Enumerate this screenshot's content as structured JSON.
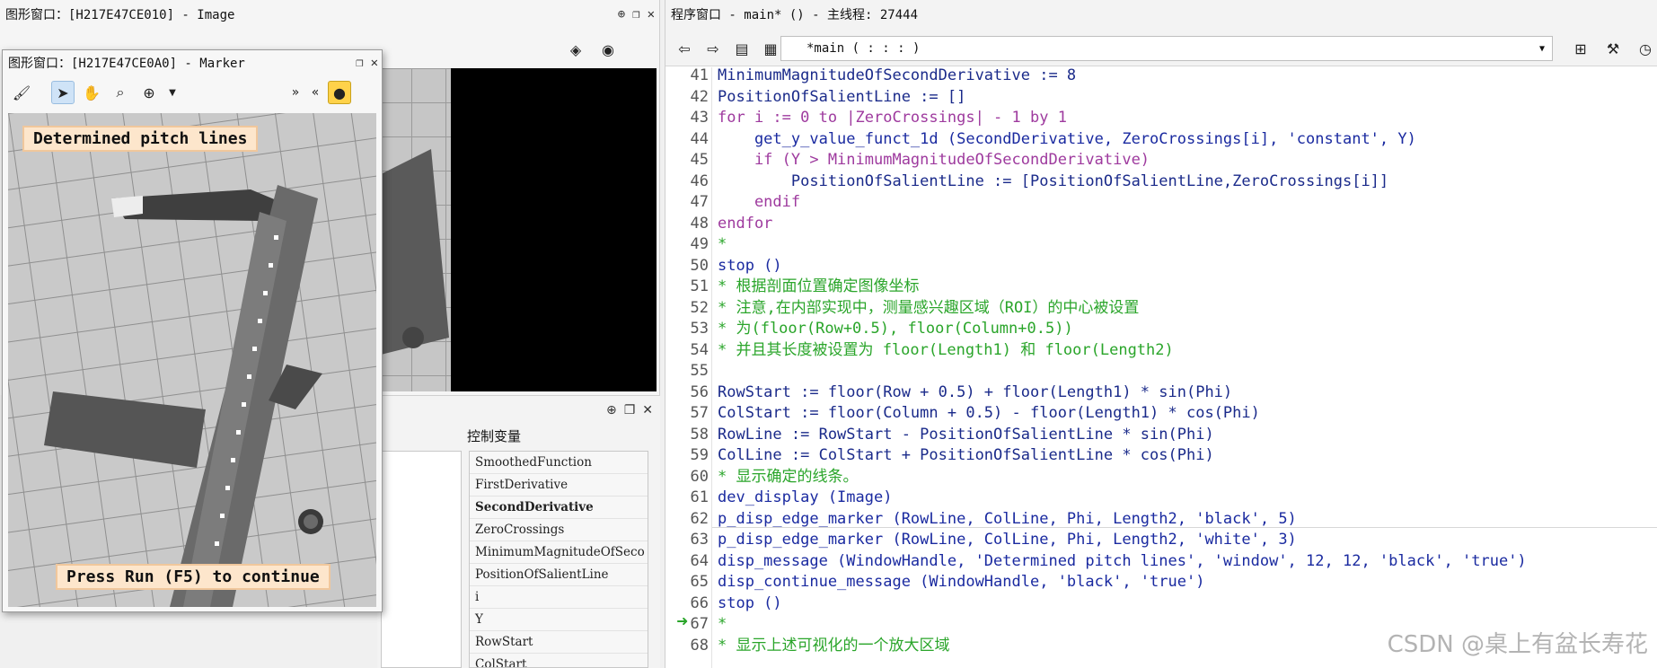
{
  "image_window": {
    "title": "图形窗口：[H217E47CE010] - Image"
  },
  "marker_window": {
    "title": "图形窗口：[H217E47CE0A0] - Marker",
    "overlay_top": "Determined pitch lines",
    "overlay_bottom": "Press Run (F5) to continue"
  },
  "vars_panel": {
    "label": "控制变量",
    "items": [
      {
        "name": "SmoothedFunction",
        "bold": false
      },
      {
        "name": "FirstDerivative",
        "bold": false
      },
      {
        "name": "SecondDerivative",
        "bold": true
      },
      {
        "name": "ZeroCrossings",
        "bold": false
      },
      {
        "name": "MinimumMagnitudeOfSeco",
        "bold": false
      },
      {
        "name": "PositionOfSalientLine",
        "bold": false
      },
      {
        "name": "i",
        "bold": false
      },
      {
        "name": "Y",
        "bold": false
      },
      {
        "name": "RowStart",
        "bold": false
      },
      {
        "name": "ColStart",
        "bold": false
      }
    ]
  },
  "program_window": {
    "title": "程序窗口 - main* () - 主线程: 27444",
    "procedure": "*main ( : : : )",
    "lines": [
      {
        "n": "41",
        "text": "MinimumMagnitudeOfSecondDerivative := 8",
        "style": "op"
      },
      {
        "n": "42",
        "text": "PositionOfSalientLine := []",
        "style": "op"
      },
      {
        "n": "43",
        "text": "for i := 0 to |ZeroCrossings| - 1 by 1",
        "style": "kw"
      },
      {
        "n": "44",
        "text": "    get_y_value_funct_1d (SecondDerivative, ZeroCrossings[i], 'constant', Y)",
        "style": "call"
      },
      {
        "n": "45",
        "text": "    if (Y > MinimumMagnitudeOfSecondDerivative)",
        "style": "kw"
      },
      {
        "n": "46",
        "text": "        PositionOfSalientLine := [PositionOfSalientLine,ZeroCrossings[i]]",
        "style": "op"
      },
      {
        "n": "47",
        "text": "    endif",
        "style": "kw"
      },
      {
        "n": "48",
        "text": "endfor",
        "style": "kw"
      },
      {
        "n": "49",
        "text": "*",
        "style": "cm"
      },
      {
        "n": "50",
        "text": "stop ()",
        "style": "call"
      },
      {
        "n": "51",
        "text": "* 根据剖面位置确定图像坐标",
        "style": "cm"
      },
      {
        "n": "52",
        "text": "* 注意,在内部实现中，测量感兴趣区域（ROI）的中心被设置",
        "style": "cm"
      },
      {
        "n": "53",
        "text": "* 为(floor(Row+0.5), floor(Column+0.5))",
        "style": "cm"
      },
      {
        "n": "54",
        "text": "* 并且其长度被设置为 floor(Length1) 和 floor(Length2)",
        "style": "cm"
      },
      {
        "n": "55",
        "text": "",
        "style": "op"
      },
      {
        "n": "56",
        "text": "RowStart := floor(Row + 0.5) + floor(Length1) * sin(Phi)",
        "style": "op"
      },
      {
        "n": "57",
        "text": "ColStart := floor(Column + 0.5) - floor(Length1) * cos(Phi)",
        "style": "op"
      },
      {
        "n": "58",
        "text": "RowLine := RowStart - PositionOfSalientLine * sin(Phi)",
        "style": "op"
      },
      {
        "n": "59",
        "text": "ColLine := ColStart + PositionOfSalientLine * cos(Phi)",
        "style": "op"
      },
      {
        "n": "60",
        "text": "* 显示确定的线条。",
        "style": "cm"
      },
      {
        "n": "61",
        "text": "dev_display (Image)",
        "style": "call"
      },
      {
        "n": "62",
        "text": "p_disp_edge_marker (RowLine, ColLine, Phi, Length2, 'black', 5)",
        "style": "call"
      },
      {
        "n": "63",
        "text": "p_disp_edge_marker (RowLine, ColLine, Phi, Length2, 'white', 3)",
        "style": "call"
      },
      {
        "n": "64",
        "text": "disp_message (WindowHandle, 'Determined pitch lines', 'window', 12, 12, 'black', 'true')",
        "style": "call"
      },
      {
        "n": "65",
        "text": "disp_continue_message (WindowHandle, 'black', 'true')",
        "style": "call"
      },
      {
        "n": "66",
        "text": "stop ()",
        "style": "call"
      },
      {
        "n": "67",
        "text": "*",
        "style": "cm"
      },
      {
        "n": "68",
        "text": "* 显示上述可视化的一个放大区域",
        "style": "cm"
      }
    ]
  },
  "watermark": "CSDN @桌上有盆长寿花"
}
